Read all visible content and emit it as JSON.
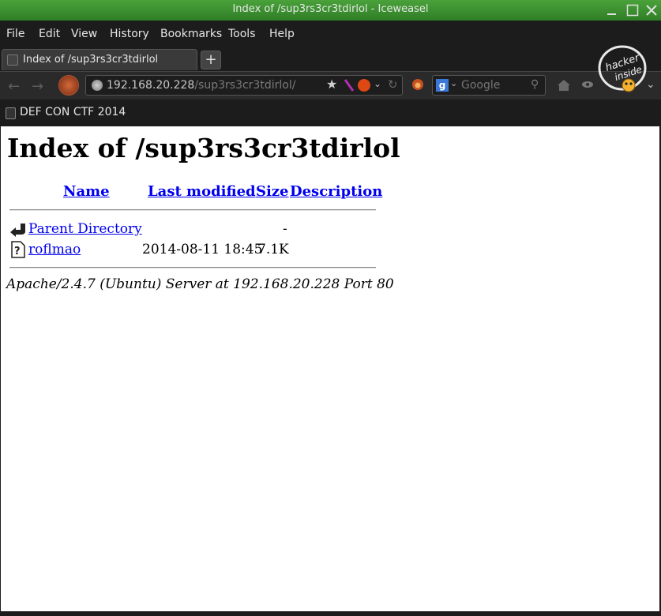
{
  "window": {
    "title": "Index of /sup3rs3cr3tdirlol - Iceweasel"
  },
  "menu": {
    "items": [
      "File",
      "Edit",
      "View",
      "History",
      "Bookmarks",
      "Tools",
      "Help"
    ]
  },
  "tab": {
    "label": "Index of /sup3rs3cr3tdirlol",
    "new_tab": "+"
  },
  "navbar": {
    "url_host": "192.168.20.228",
    "url_path": "/sup3rs3cr3tdirlol/",
    "search_placeholder": "Google",
    "icons": [
      "back-arrow-icon",
      "forward-arrow-icon",
      "globe-icon",
      "star-icon",
      "ubuntu-icon",
      "reload-icon",
      "home-icon"
    ]
  },
  "badge": {
    "line1": "hacker",
    "line2": "inside"
  },
  "bookmarks": {
    "items": [
      "DEF CON CTF 2014"
    ]
  },
  "page": {
    "heading": "Index of /sup3rs3cr3tdirlol",
    "columns": {
      "name": "Name",
      "last_modified": "Last modified",
      "size": "Size",
      "description": "Description"
    },
    "rows": [
      {
        "name": "Parent Directory",
        "modified": "",
        "size": "-",
        "icon": "back-folder-icon"
      },
      {
        "name": "roflmao",
        "modified": "2014-08-11 18:45",
        "size": "7.1K",
        "icon": "unknown-file-icon"
      }
    ],
    "footer": "Apache/2.4.7 (Ubuntu) Server at 192.168.20.228 Port 80"
  }
}
